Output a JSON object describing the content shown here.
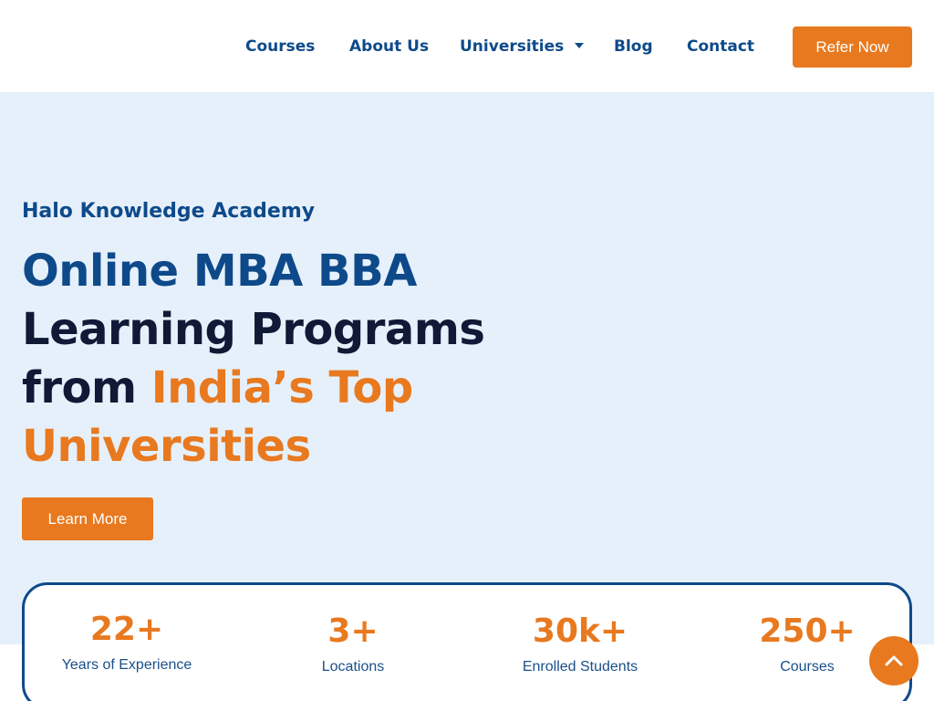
{
  "colors": {
    "brand_blue": "#0e4a8a",
    "brand_orange": "#e8791f",
    "dark_text": "#101935",
    "hero_background": "#e6f0fb"
  },
  "header": {
    "nav": {
      "courses": "Courses",
      "about": "About Us",
      "universities": "Universities",
      "blog": "Blog",
      "contact": "Contact"
    },
    "refer_button": "Refer Now"
  },
  "hero": {
    "eyebrow": "Halo Knowledge Academy",
    "title": {
      "part1": "Online MBA BBA",
      "part2": "Learning Programs",
      "part3": "from ",
      "part4": "India’s Top",
      "part5": "Universities"
    },
    "cta": "Learn More"
  },
  "stats": [
    {
      "value": "22+",
      "label": "Years of Experience"
    },
    {
      "value": "3+",
      "label": "Locations"
    },
    {
      "value": "30k+",
      "label": "Enrolled Students"
    },
    {
      "value": "250+",
      "label": "Courses"
    }
  ],
  "icons": {
    "universities_dropdown": "caret-down-icon",
    "scroll_top": "chevron-up-icon"
  }
}
